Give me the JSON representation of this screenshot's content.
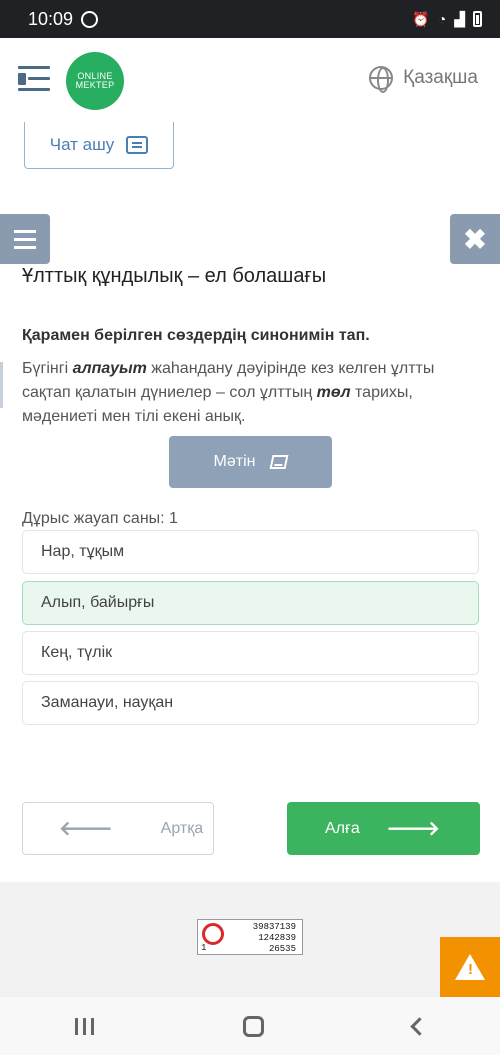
{
  "status_bar": {
    "time": "10:09"
  },
  "header": {
    "logo_line1": "ONLINE",
    "logo_line2": "MEKTEP",
    "language": "Қазақша"
  },
  "chat_button": {
    "label": "Чат ашу"
  },
  "lesson": {
    "title": "Ұлттық құндылық – ел болашағы"
  },
  "question": {
    "prompt": "Қарамен берілген сөздердің синонимін тап.",
    "passage_part1": "Бүгінгі ",
    "highlight1": "алпауыт",
    "passage_part2": " жаһандану дәуірінде кез келген ұлтты сақтап қалатын дүниелер – сол ұлттың ",
    "highlight2": "төл",
    "passage_part3": " тарихы, мәдениеті мен тілі екені анық.",
    "text_button": "Мәтін",
    "correct_count_label": "Дұрыс жауап саны: 1"
  },
  "options": [
    {
      "label": "Нар, тұқым",
      "selected": false
    },
    {
      "label": "Алып, байырғы",
      "selected": true
    },
    {
      "label": "Кең, түлік",
      "selected": false
    },
    {
      "label": "Заманауи, науқан",
      "selected": false
    }
  ],
  "navigation": {
    "back_label": "Артқа",
    "next_label": "Алға"
  },
  "counter_widget": {
    "line1": "39837139",
    "line2": "1242839",
    "line3": "26535",
    "corner": "1"
  },
  "colors": {
    "accent_green": "#3cb35f",
    "selected_bg": "#e9f7ef",
    "report_orange": "#f39200",
    "side_button": "#8a9bb0"
  }
}
